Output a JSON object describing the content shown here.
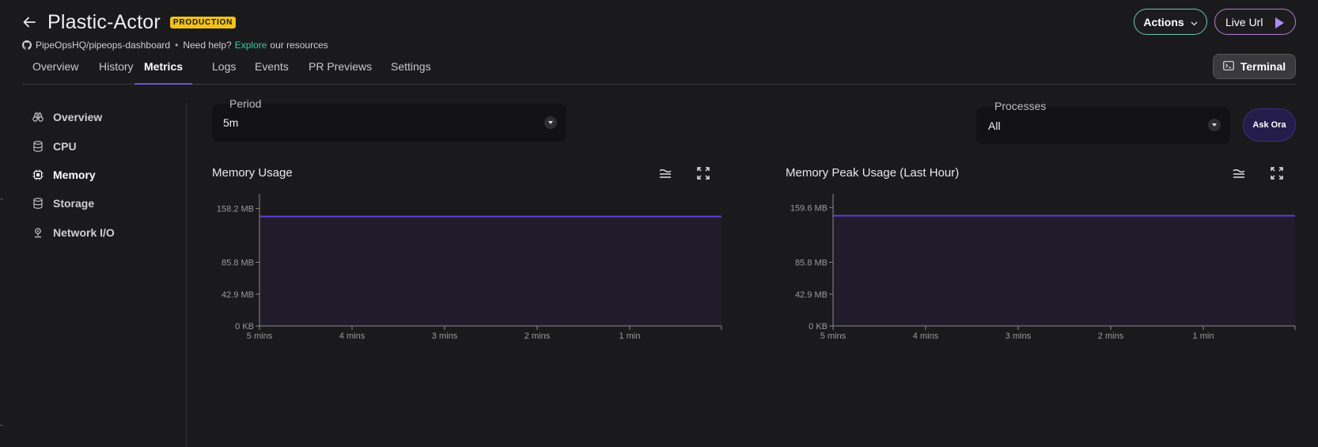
{
  "header": {
    "title": "Plastic-Actor",
    "badge": "PRODUCTION",
    "repo": "PipeOpsHQ/pipeops-dashboard",
    "separator": "•",
    "help_prefix": "Need help?",
    "help_link": "Explore",
    "help_suffix": "our resources",
    "actions_label": "Actions",
    "live_url_label": "Live Url"
  },
  "tabs": [
    {
      "label": "Overview"
    },
    {
      "label": "History"
    },
    {
      "label": "Metrics",
      "active": true
    },
    {
      "label": "Logs"
    },
    {
      "label": "Events"
    },
    {
      "label": "PR Previews"
    },
    {
      "label": "Settings"
    }
  ],
  "terminal_label": "Terminal",
  "sidebar": {
    "items": [
      {
        "label": "Overview",
        "icon": "binoculars-icon"
      },
      {
        "label": "CPU",
        "icon": "database-icon"
      },
      {
        "label": "Memory",
        "icon": "chip-icon",
        "active": true
      },
      {
        "label": "Storage",
        "icon": "database-icon"
      },
      {
        "label": "Network I/O",
        "icon": "network-icon"
      }
    ]
  },
  "filters": {
    "period_label": "Period",
    "period_value": "5m",
    "processes_label": "Processes",
    "processes_value": "All",
    "ask_label": "Ask Ora"
  },
  "colors": {
    "accent": "#6b54d6",
    "line": "#5a3fd1",
    "area": "#201c2c",
    "link": "#3ec9a7",
    "badge": "#f2c21a"
  },
  "chart_data": [
    {
      "type": "area",
      "title": "Memory Usage",
      "x": [
        "5 mins",
        "4 mins",
        "3 mins",
        "2 mins",
        "1 min"
      ],
      "y_ticks": [
        "158.2 MB",
        "85.8 MB",
        "42.9 MB",
        "0 KB"
      ],
      "y_tick_values": [
        158.2,
        85.8,
        42.9,
        0
      ],
      "ylim": [
        0,
        171.6
      ],
      "series": [
        {
          "values": [
            147.5,
            147.5,
            147.5,
            147.5,
            147.5,
            147.5
          ]
        }
      ]
    },
    {
      "type": "area",
      "title": "Memory Peak Usage (Last Hour)",
      "x": [
        "5 mins",
        "4 mins",
        "3 mins",
        "2 mins",
        "1 min"
      ],
      "y_ticks": [
        "159.6 MB",
        "85.8 MB",
        "42.9 MB",
        "0 KB"
      ],
      "y_tick_values": [
        159.6,
        85.8,
        42.9,
        0
      ],
      "ylim": [
        0,
        171.6
      ],
      "series": [
        {
          "values": [
            148.5,
            148.5,
            148.5,
            148.5,
            148.5,
            148.5
          ]
        }
      ]
    }
  ]
}
